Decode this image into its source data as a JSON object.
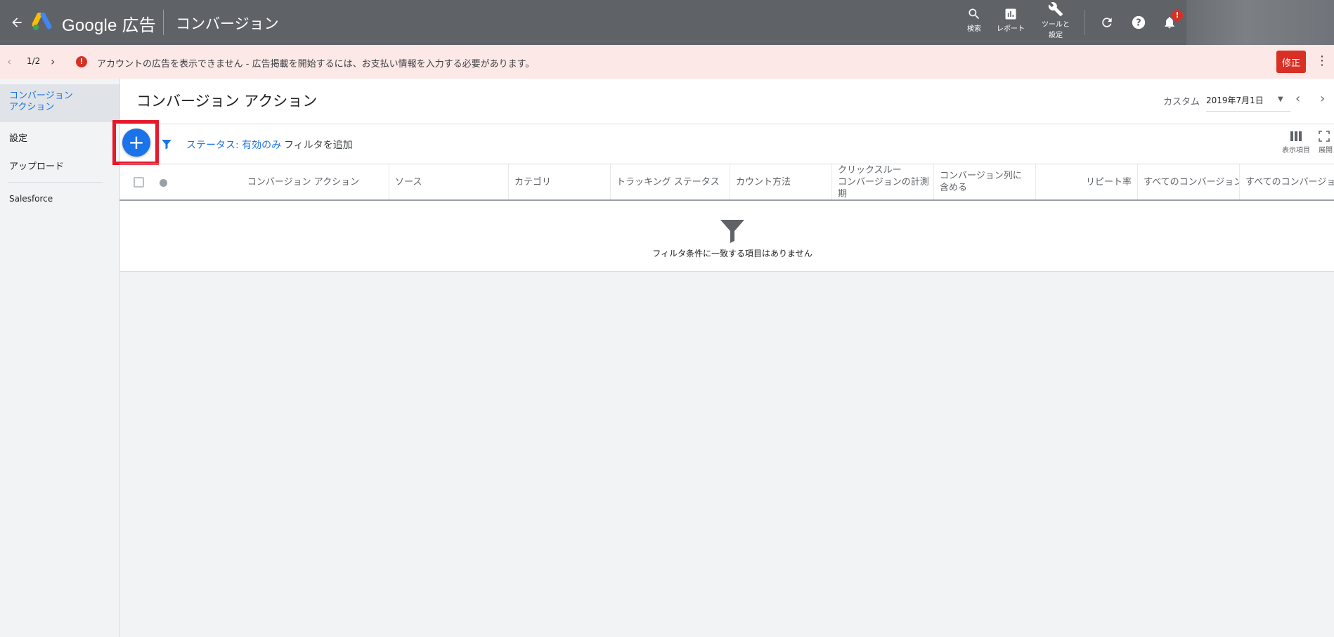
{
  "topbar": {
    "brand": "Google 広告",
    "section": "コンバージョン",
    "tools": {
      "search_label": "検索",
      "reports_label": "レポート",
      "tools_label_line1": "ツールと",
      "tools_label_line2": "設定"
    },
    "notification_badge": "!"
  },
  "alert": {
    "page_count": "1/2",
    "icon": "!",
    "message": "アカウントの広告を表示できません - 広告掲載を開始するには、お支払い情報を入力する必要があります。",
    "fix_button": "修正"
  },
  "sidebar": {
    "items": [
      {
        "label_line1": "コンバージョン",
        "label_line2": "アクション"
      },
      {
        "label": "設定"
      },
      {
        "label": "アップロード"
      },
      {
        "label": "Salesforce"
      }
    ]
  },
  "main": {
    "title": "コンバージョン アクション",
    "date_range_label": "カスタム",
    "date_value": "2019年7月1日"
  },
  "toolbar": {
    "filter_status": "ステータス: 有効のみ",
    "add_filter": "フィルタを追加",
    "columns_label": "表示項目",
    "expand_label": "展開"
  },
  "table": {
    "columns": [
      "コンバージョン アクション",
      "ソース",
      "カテゴリ",
      "トラッキング ステータス",
      "カウント方法",
      "クリックスルー\nコンバージョンの計測期",
      "コンバージョン列に\n含める",
      "リピート率",
      "すべてのコンバージョン",
      "すべてのコンバージョン"
    ]
  },
  "empty_state": {
    "message": "フィルタ条件に一致する項目はありません"
  },
  "colors": {
    "topbar": "#5f6368",
    "accent": "#1a73e8",
    "alert_bg": "#fce8e6",
    "error": "#d93025",
    "highlight": "#e6192b"
  }
}
